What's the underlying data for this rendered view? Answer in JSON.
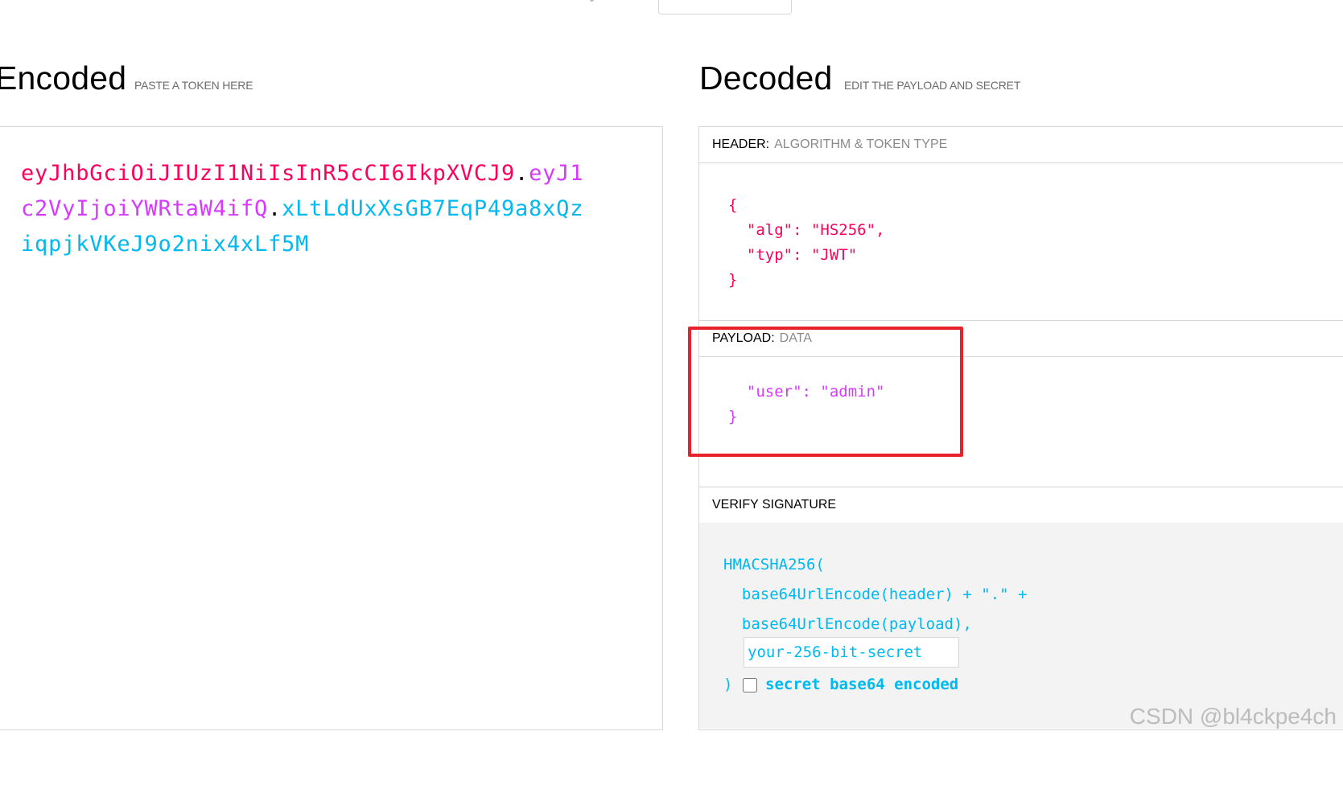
{
  "encoded": {
    "title": "Encoded",
    "subtitle": "PASTE A TOKEN HERE",
    "token_header": "eyJhbGciOiJIUzI1NiIsInR5cCI6IkpXVCJ9",
    "token_payload": "eyJ1c2VyIjoiYWRtaW4ifQ",
    "token_signature": "xLtLdUxXsGB7EqP49a8xQziqpjkVKeJ9o2nix4xLf5M",
    "dot": "."
  },
  "decoded": {
    "title": "Decoded",
    "subtitle": "EDIT THE PAYLOAD AND SECRET",
    "header_section": {
      "label": "HEADER:",
      "sublabel": "ALGORITHM & TOKEN TYPE",
      "code": "{\n  \"alg\": \"HS256\",\n  \"typ\": \"JWT\"\n}"
    },
    "payload_section": {
      "label": "PAYLOAD:",
      "sublabel": "DATA",
      "code": "  \"user\": \"admin\"\n}"
    },
    "verify_section": {
      "label": "VERIFY SIGNATURE",
      "code": "HMACSHA256(\n  base64UrlEncode(header) + \".\" +\n  base64UrlEncode(payload),",
      "secret_placeholder": "your-256-bit-secret",
      "close_paren": ")",
      "base64_label": "secret base64 encoded"
    }
  },
  "colors": {
    "header": "#fb015b",
    "payload": "#d63aff",
    "signature": "#00b9f1",
    "annotation": "#e8222b"
  },
  "watermark": "CSDN @bl4ckpe4ch"
}
